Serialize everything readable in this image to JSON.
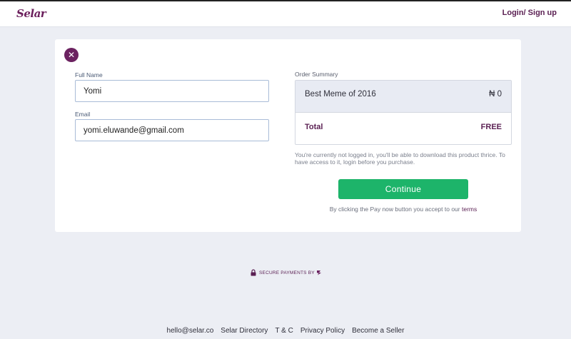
{
  "header": {
    "logo": "Selar",
    "login_label": "Login/ Sign up"
  },
  "form": {
    "close_icon": "close-icon",
    "full_name": {
      "label": "Full Name",
      "value": "Yomi"
    },
    "email": {
      "label": "Email",
      "value": "yomi.eluwande@gmail.com"
    }
  },
  "summary": {
    "label": "Order Summary",
    "item_name": "Best Meme of 2016",
    "item_price": "₦ 0",
    "total_label": "Total",
    "total_value": "FREE"
  },
  "notice": "You're currently not logged in, you'll be able to download this product thrice. To have access to it, login before you purchase.",
  "continue_label": "Continue",
  "terms": {
    "prefix": "By clicking the Pay now button you accept to our",
    "link": "terms"
  },
  "secure_label": "SECURE PAYMENTS BY",
  "footer": {
    "links": [
      "hello@selar.co",
      "Selar Directory",
      "T & C",
      "Privacy Policy",
      "Become a Seller"
    ]
  },
  "colors": {
    "brand": "#6b2260",
    "accent_green": "#1db46a",
    "background": "#eceef4"
  }
}
